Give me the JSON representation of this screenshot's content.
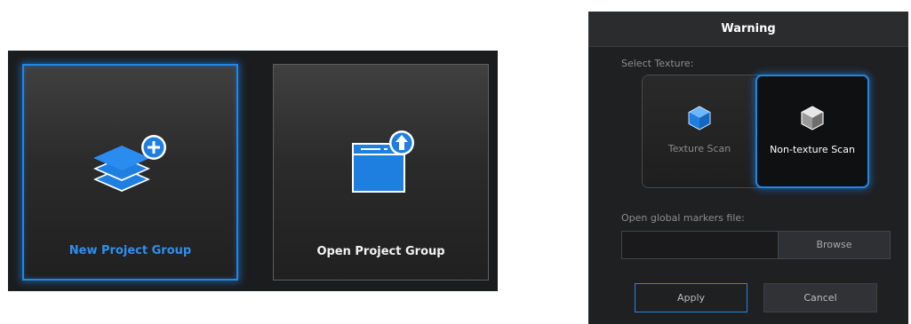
{
  "project_panel": {
    "new_group": {
      "label": "New Project Group",
      "icon": "layers-add-icon",
      "selected": true
    },
    "open_group": {
      "label": "Open Project Group",
      "icon": "window-upload-icon",
      "selected": false
    }
  },
  "warning_dialog": {
    "title": "Warning",
    "select_texture_label": "Select Texture:",
    "texture_options": [
      {
        "label": "Texture Scan",
        "icon": "blue-cube-icon",
        "selected": false
      },
      {
        "label": "Non-texture Scan",
        "icon": "grey-cube-icon",
        "selected": true
      }
    ],
    "markers_label": "Open global markers file:",
    "markers_value": "",
    "browse_label": "Browse",
    "apply_label": "Apply",
    "cancel_label": "Cancel"
  },
  "colors": {
    "accent": "#1f87e8",
    "panel_bg": "#1b1c1e",
    "dialog_bg": "#1f2022"
  }
}
